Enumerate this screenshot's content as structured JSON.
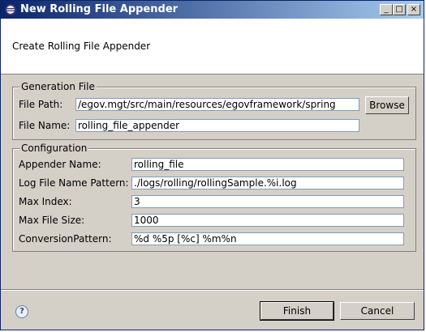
{
  "window": {
    "title": "New Rolling File Appender",
    "controls": {
      "minimize": "_",
      "maximize": "□",
      "close": "×"
    }
  },
  "banner": {
    "message": "Create Rolling File Appender"
  },
  "generation_file": {
    "legend": "Generation File",
    "file_path_label": "File Path:",
    "file_path_value": "/egov.mgt/src/main/resources/egovframework/spring",
    "browse_label": "Browse",
    "file_name_label": "File Name:",
    "file_name_value": "rolling_file_appender"
  },
  "configuration": {
    "legend": "Configuration",
    "fields": [
      {
        "label": "Appender Name:",
        "value": "rolling_file"
      },
      {
        "label": "Log File Name Pattern:",
        "value": "./logs/rolling/rollingSample.%i.log"
      },
      {
        "label": "Max Index:",
        "value": "3"
      },
      {
        "label": "Max File Size:",
        "value": "1000"
      },
      {
        "label": "ConversionPattern:",
        "value": "%d %5p [%c] %m%n"
      }
    ]
  },
  "footer": {
    "finish_label": "Finish",
    "cancel_label": "Cancel"
  },
  "colors": {
    "title_start": "#0a246a",
    "title_end": "#a6caf0",
    "dialog_bg": "#d4d0c8"
  }
}
